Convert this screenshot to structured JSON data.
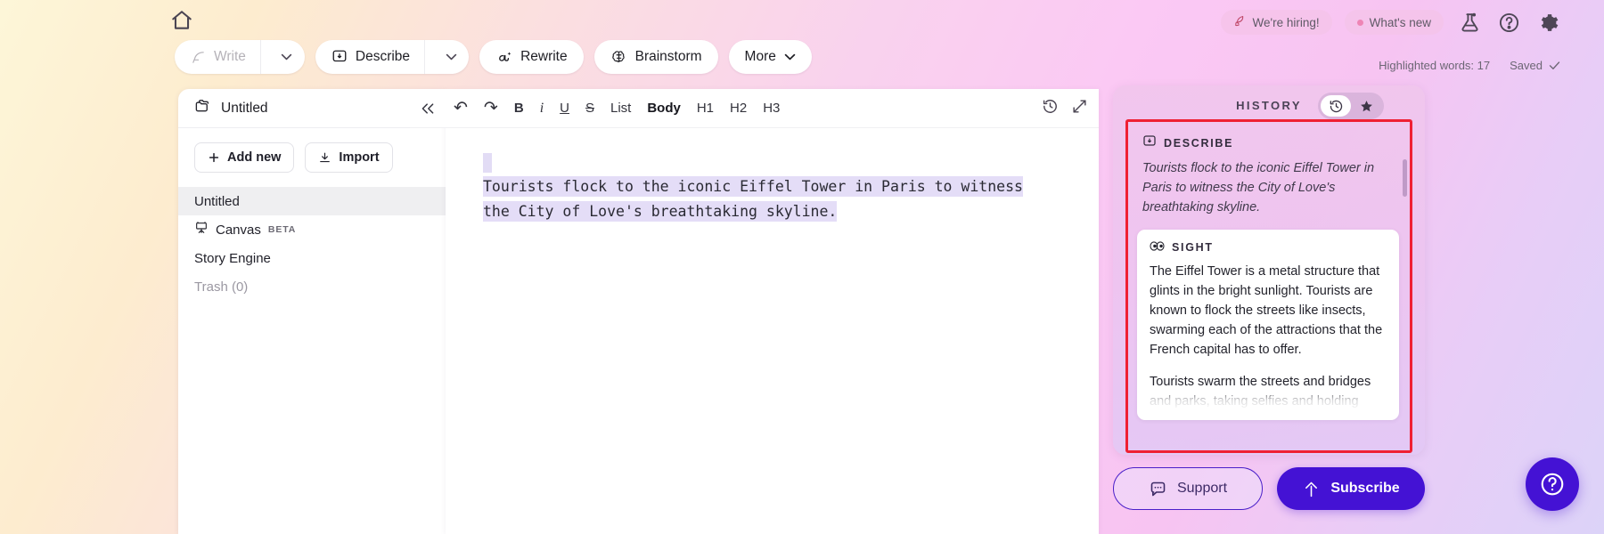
{
  "topbar": {
    "home_icon": "home-icon",
    "tools": [
      {
        "label": "Write",
        "icon": "feather-icon",
        "has_caret": true,
        "disabled": true
      },
      {
        "label": "Describe",
        "icon": "describe-icon",
        "has_caret": true,
        "disabled": false
      },
      {
        "label": "Rewrite",
        "icon": "rewrite-icon",
        "has_caret": false,
        "disabled": false
      },
      {
        "label": "Brainstorm",
        "icon": "brain-icon",
        "has_caret": false,
        "disabled": false
      },
      {
        "label": "More",
        "icon": "",
        "has_caret": true,
        "disabled": false
      }
    ],
    "hiring_chip": "We're hiring!",
    "whats_new_chip": "What's new",
    "icons": [
      "flask-icon",
      "help-circle-icon",
      "gear-icon"
    ],
    "highlighted_words": "Highlighted words: 17",
    "saved": "Saved"
  },
  "sidebar": {
    "folder_title": "Untitled",
    "add_new": "Add new",
    "import": "Import",
    "documents": [
      {
        "label": "Untitled",
        "selected": true,
        "muted": false,
        "icon": "",
        "badge": ""
      },
      {
        "label": "Canvas",
        "selected": false,
        "muted": false,
        "icon": "easel-icon",
        "badge": "BETA"
      },
      {
        "label": "Story Engine",
        "selected": false,
        "muted": false,
        "icon": "",
        "badge": ""
      },
      {
        "label": "Trash (0)",
        "selected": false,
        "muted": true,
        "icon": "",
        "badge": ""
      }
    ]
  },
  "editor": {
    "collapse_icon": "collapse-left-icon",
    "toolbar": [
      {
        "label": "↶",
        "name": "undo",
        "style": "plain"
      },
      {
        "label": "↷",
        "name": "redo",
        "style": "plain"
      },
      {
        "label": "B",
        "name": "bold",
        "style": "b"
      },
      {
        "label": "i",
        "name": "italic",
        "style": "i"
      },
      {
        "label": "U",
        "name": "underline",
        "style": "u"
      },
      {
        "label": "S",
        "name": "strikethrough",
        "style": "s"
      },
      {
        "label": "List",
        "name": "list",
        "style": "plain"
      },
      {
        "label": "Body",
        "name": "body",
        "style": "active"
      },
      {
        "label": "H1",
        "name": "heading-1",
        "style": "plain"
      },
      {
        "label": "H2",
        "name": "heading-2",
        "style": "plain"
      },
      {
        "label": "H3",
        "name": "heading-3",
        "style": "plain"
      }
    ],
    "right_icons": [
      "history-clock-icon",
      "expand-icon"
    ],
    "document_text": "Tourists flock to the iconic Eiffel Tower in Paris to witness the City of Love's breathtaking skyline."
  },
  "history_panel": {
    "title": "HISTORY",
    "toggle": [
      "history-clock-icon",
      "star-icon"
    ],
    "entries": [
      {
        "label": "DESCRIBE",
        "icon": "describe-icon",
        "style": "transparent",
        "body": "Tourists flock to the iconic Eiffel Tower in Paris to witness the City of Love's breathtaking skyline."
      },
      {
        "label": "SIGHT",
        "icon": "eyes-icon",
        "style": "card",
        "body": "The Eiffel Tower is a metal structure that glints in the bright sunlight. Tourists are known to flock the streets like insects, swarming each of the attractions that the French capital has to offer.",
        "body_continued": "Tourists swarm the streets and bridges and parks, taking selfies and holding"
      }
    ]
  },
  "footer": {
    "support": "Support",
    "subscribe": "Subscribe",
    "help_bubble": "chat-help-icon"
  },
  "colors": {
    "accent": "#4412d4",
    "highlight_box": "#ef2033",
    "text_selection": "#e4ddf7"
  }
}
